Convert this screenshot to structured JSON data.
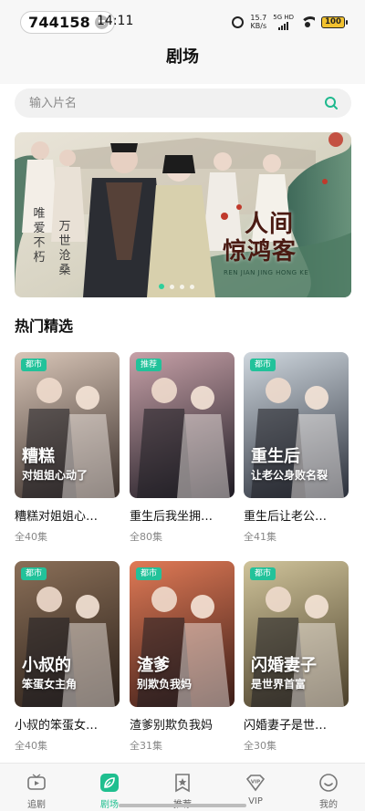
{
  "status_bar": {
    "badge_number": "744158",
    "time": "14:11",
    "net_speed": "15.7",
    "net_unit": "KB/s",
    "signal_label": "5G HD",
    "battery": "100"
  },
  "header": {
    "title": "剧场"
  },
  "search": {
    "placeholder": "输入片名",
    "value": ""
  },
  "banner": {
    "title_line1": "人间",
    "title_line2": "惊鸿客",
    "subtitle": "REN JIAN JING HONG KE",
    "slogan_left": "唯爱不朽",
    "slogan_right": "万世沧桑",
    "dots_total": 4,
    "active_dot": 0
  },
  "section": {
    "title": "热门精选"
  },
  "cards": [
    {
      "tag": "都市",
      "title": "糟糕对姐姐心…",
      "episodes": "全40集",
      "poster_text": "糟糕",
      "poster_text2": "对姐姐心动了",
      "colors": [
        "#d9c6b8",
        "#3a2f2a"
      ]
    },
    {
      "tag": "推荐",
      "title": "重生后我坐拥…",
      "episodes": "全80集",
      "poster_text": "",
      "poster_text2": "",
      "colors": [
        "#c7a1a8",
        "#1d1a22"
      ]
    },
    {
      "tag": "都市",
      "title": "重生后让老公…",
      "episodes": "全41集",
      "poster_text": "重生后",
      "poster_text2": "让老公身败名裂",
      "colors": [
        "#cfd7de",
        "#2a2f3a"
      ]
    },
    {
      "tag": "都市",
      "title": "小叔的笨蛋女…",
      "episodes": "全40集",
      "poster_text": "小叔的",
      "poster_text2": "笨蛋女主角",
      "colors": [
        "#8a6f58",
        "#2b2019"
      ]
    },
    {
      "tag": "都市",
      "title": "渣爹别欺负我妈",
      "episodes": "全31集",
      "poster_text": "渣爹",
      "poster_text2": "别欺负我妈",
      "colors": [
        "#e07a56",
        "#3a1c17"
      ]
    },
    {
      "tag": "都市",
      "title": "闪婚妻子是世…",
      "episodes": "全30集",
      "poster_text": "闪婚妻子",
      "poster_text2": "是世界首富",
      "colors": [
        "#cfc39a",
        "#4a3f2a"
      ]
    }
  ],
  "bottom_nav": {
    "items": [
      {
        "label": "追剧",
        "icon": "tv-icon"
      },
      {
        "label": "剧场",
        "icon": "theater-leaf-icon"
      },
      {
        "label": "推荐",
        "icon": "recommend-star-icon"
      },
      {
        "label": "VIP",
        "icon": "vip-diamond-icon"
      },
      {
        "label": "我的",
        "icon": "profile-smile-icon"
      }
    ],
    "active_index": 1
  },
  "colors": {
    "accent": "#22c29a",
    "active_nav": "#1fbf8f"
  }
}
